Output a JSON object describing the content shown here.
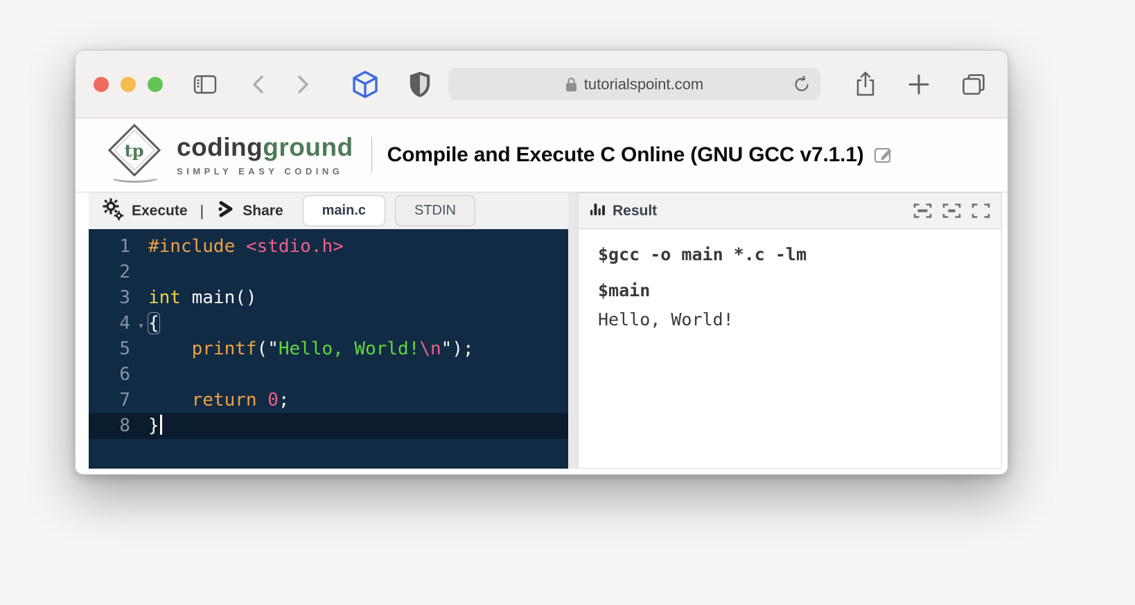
{
  "browser": {
    "url": "tutorialspoint.com"
  },
  "header": {
    "logo": {
      "monogram": "tp",
      "coding": "coding",
      "ground": "ground",
      "tagline": "SIMPLY EASY CODING"
    },
    "title": "Compile and Execute C Online (GNU GCC v7.1.1)"
  },
  "editor_panel": {
    "toolbar": {
      "execute_label": "Execute",
      "divider": "|",
      "share_label": "Share",
      "tabs": [
        {
          "label": "main.c",
          "active": true
        },
        {
          "label": "STDIN",
          "active": false
        }
      ]
    },
    "editor": {
      "language": "c",
      "active_line": 8,
      "lines": [
        {
          "n": 1,
          "tokens": [
            {
              "t": "#include",
              "c": "orange"
            },
            {
              "t": " ",
              "c": "plain"
            },
            {
              "t": "<stdio.h>",
              "c": "pink"
            }
          ]
        },
        {
          "n": 2,
          "tokens": []
        },
        {
          "n": 3,
          "tokens": [
            {
              "t": "int",
              "c": "yellow"
            },
            {
              "t": " main()",
              "c": "plain"
            }
          ]
        },
        {
          "n": 4,
          "fold": true,
          "tokens": [
            {
              "t": "{",
              "c": "plain",
              "box": true
            }
          ]
        },
        {
          "n": 5,
          "tokens": [
            {
              "t": "    ",
              "c": "plain"
            },
            {
              "t": "printf",
              "c": "orange"
            },
            {
              "t": "(\"",
              "c": "plain"
            },
            {
              "t": "Hello, World!",
              "c": "green"
            },
            {
              "t": "\\n",
              "c": "pink"
            },
            {
              "t": "\");",
              "c": "plain"
            }
          ]
        },
        {
          "n": 6,
          "tokens": []
        },
        {
          "n": 7,
          "tokens": [
            {
              "t": "    ",
              "c": "plain"
            },
            {
              "t": "return",
              "c": "orange"
            },
            {
              "t": " ",
              "c": "plain"
            },
            {
              "t": "0",
              "c": "pink"
            },
            {
              "t": ";",
              "c": "plain"
            }
          ]
        },
        {
          "n": 8,
          "cursor": true,
          "tokens": [
            {
              "t": "}",
              "c": "plain"
            }
          ]
        }
      ]
    }
  },
  "result_panel": {
    "title": "Result",
    "output_lines": [
      {
        "text": "$gcc -o main *.c -lm",
        "bold": true
      },
      {
        "text": "$main",
        "bold": true
      },
      {
        "text": "Hello, World!",
        "bold": false
      }
    ]
  },
  "colors": {
    "tl-red": "#ee6a5f",
    "tl-yellow": "#f5bd4f",
    "tl-green": "#61c454",
    "accent-blue": "#3c6cde",
    "logo-green": "#4e7c55",
    "editor-bg": "#112b45",
    "editor-active": "#0a1c2e",
    "gutter-fg": "#8494a5",
    "syn-plain": "#f8f8f8",
    "syn-orange": "#eda243",
    "syn-yellow": "#e8d44f",
    "syn-pink": "#f0608b",
    "syn-green": "#62d63e"
  }
}
